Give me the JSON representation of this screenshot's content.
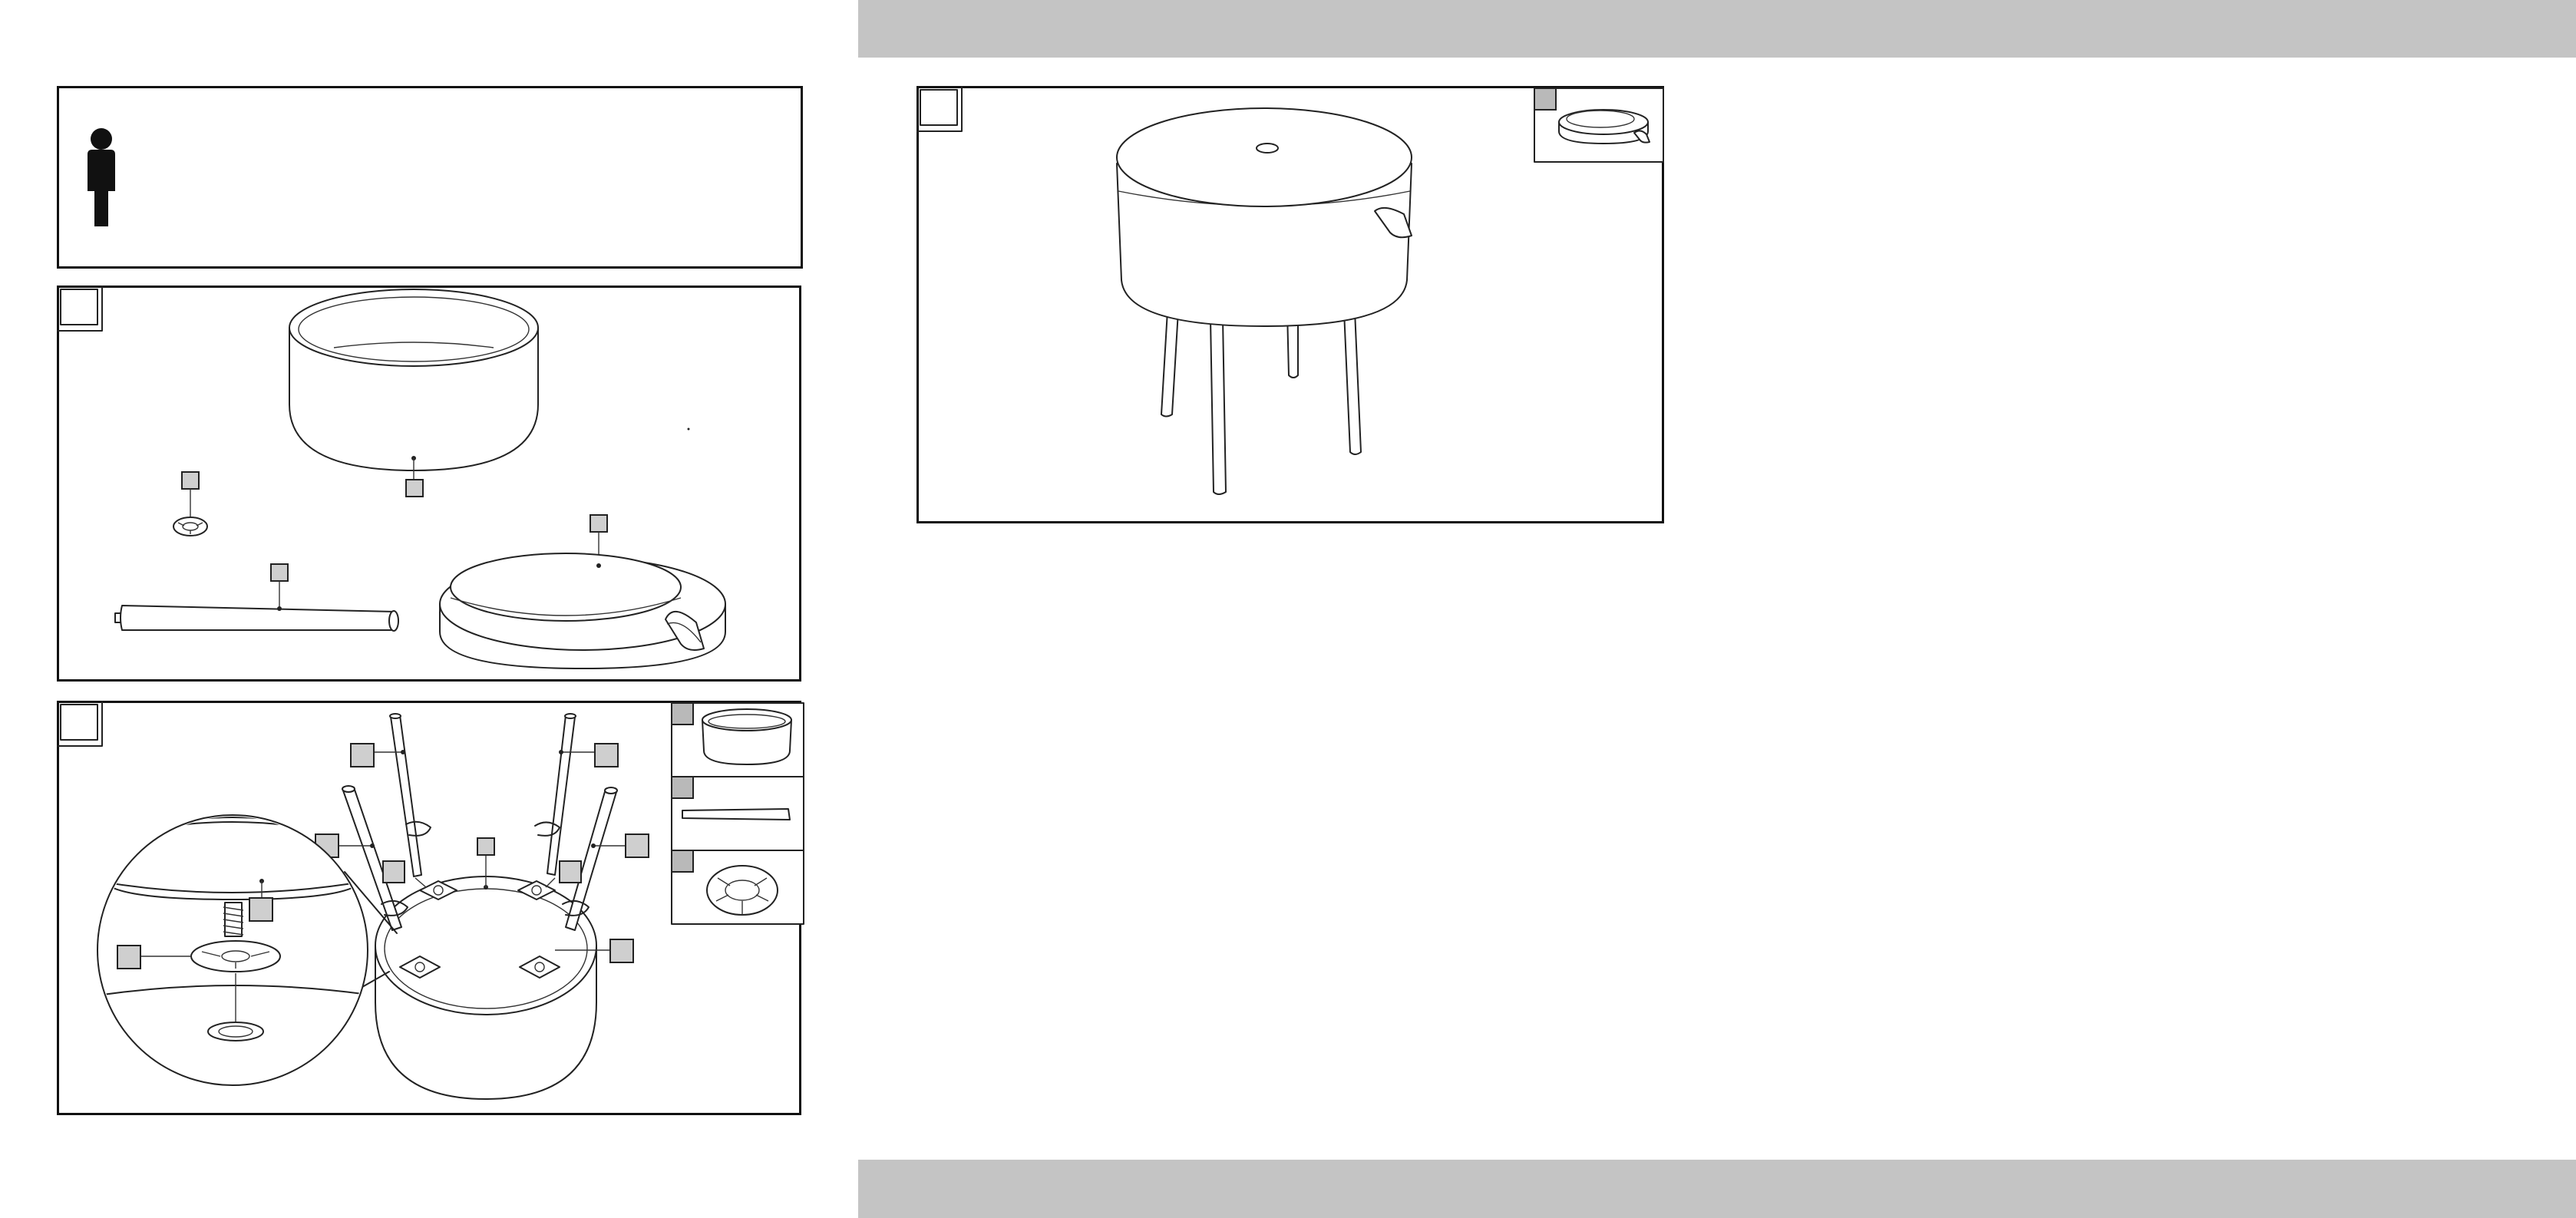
{
  "document": {
    "type": "assembly-instructions",
    "steps": [
      {
        "id": "persons",
        "icon": "person-icon"
      },
      {
        "id": "parts",
        "parts": [
          "body",
          "foot",
          "leg",
          "lid"
        ]
      },
      {
        "id": "assembly",
        "parts_used": [
          "body",
          "leg",
          "foot"
        ]
      },
      {
        "id": "finished",
        "parts_used": [
          "lid"
        ]
      }
    ]
  },
  "colors": {
    "band": "#c4c4c4",
    "frame": "#111111",
    "label_box": "#cfcfcf",
    "part_tag": "#b9b9b9"
  }
}
